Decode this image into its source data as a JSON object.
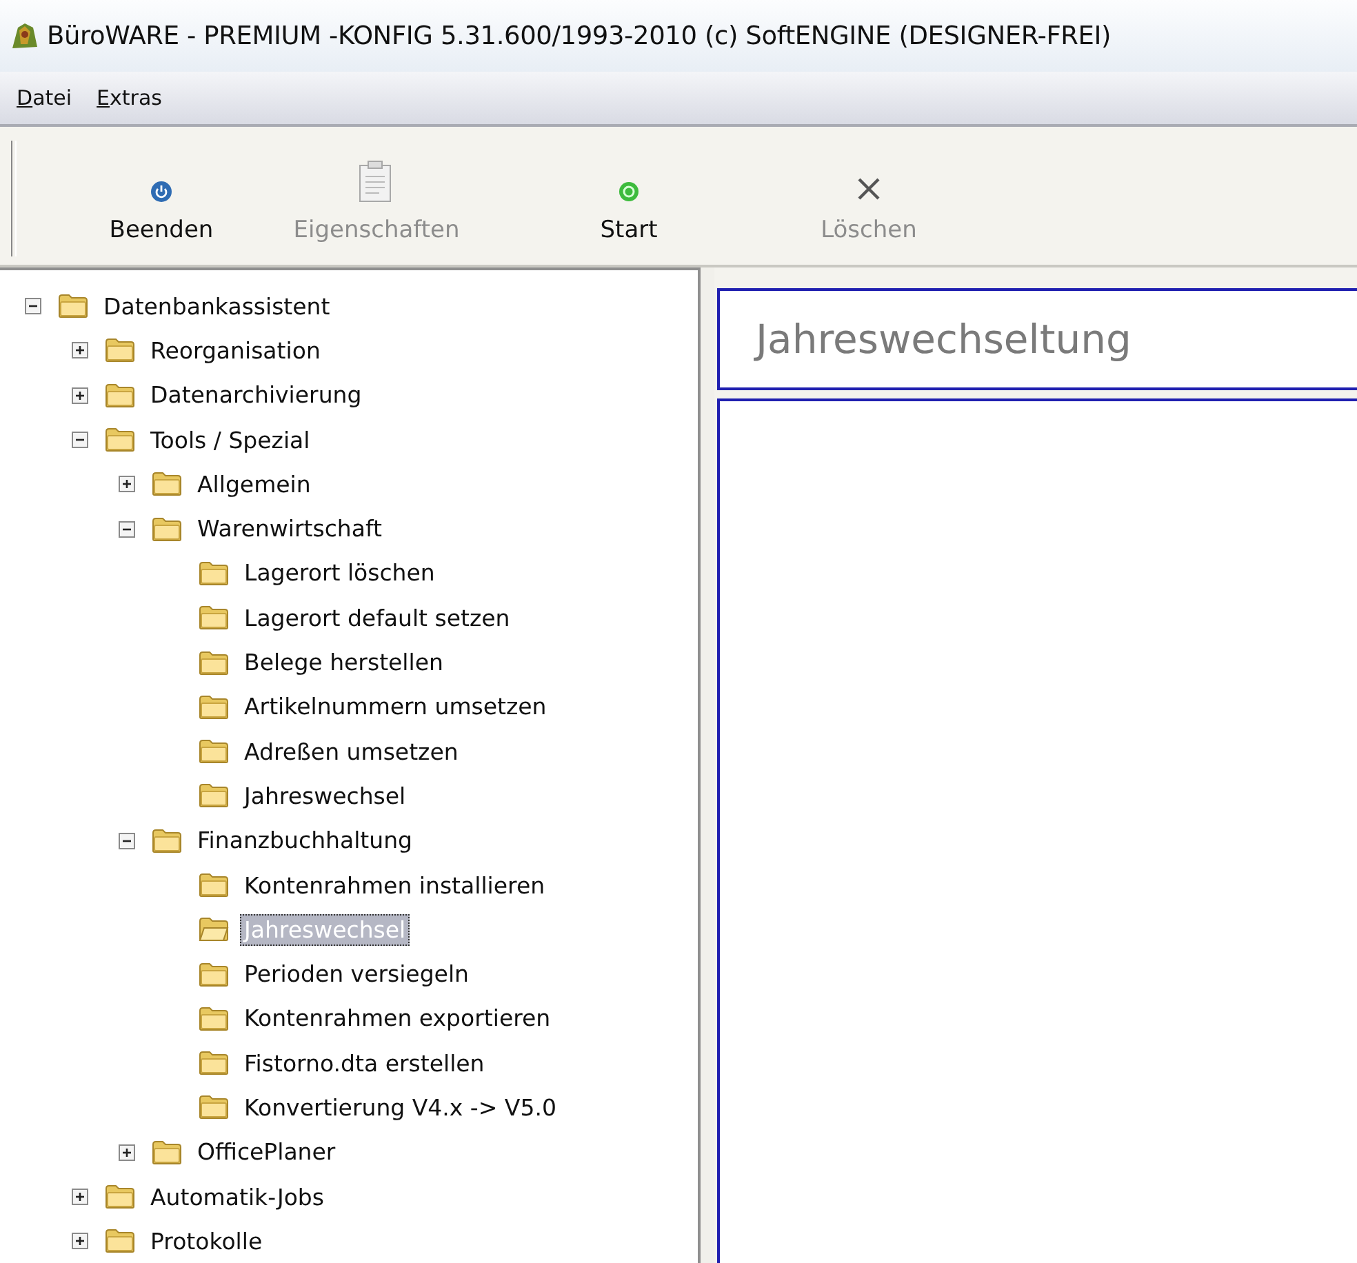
{
  "window": {
    "title": "BüroWARE - PREMIUM -KONFIG 5.31.600/1993-2010 (c) SoftENGINE (DESIGNER-FREI)"
  },
  "menu": [
    "Datei",
    "Extras"
  ],
  "toolbar": [
    {
      "kind": "power",
      "label": "Beenden",
      "disabled": false
    },
    {
      "kind": "properties",
      "label": "Eigenschaften",
      "disabled": true
    },
    {
      "kind": "start",
      "label": "Start",
      "disabled": false
    },
    {
      "kind": "delete",
      "label": "Löschen",
      "disabled": true
    }
  ],
  "tree": [
    {
      "label": "Datenbankassistent",
      "expanded": true,
      "selected": false,
      "children": [
        {
          "label": "Reorganisation",
          "expanded": false,
          "selected": false
        },
        {
          "label": "Datenarchivierung",
          "expanded": false,
          "selected": false
        },
        {
          "label": "Tools / Spezial",
          "expanded": true,
          "selected": false,
          "children": [
            {
              "label": "Allgemein",
              "expanded": false,
              "selected": false
            },
            {
              "label": "Warenwirtschaft",
              "expanded": true,
              "selected": false,
              "children": [
                {
                  "label": "Lagerort löschen",
                  "selected": false
                },
                {
                  "label": "Lagerort default setzen",
                  "selected": false
                },
                {
                  "label": "Belege herstellen",
                  "selected": false
                },
                {
                  "label": "Artikelnummern umsetzen",
                  "selected": false
                },
                {
                  "label": "Adreßen umsetzen",
                  "selected": false
                },
                {
                  "label": "Jahreswechsel",
                  "selected": false
                }
              ]
            },
            {
              "label": "Finanzbuchhaltung",
              "expanded": true,
              "selected": false,
              "children": [
                {
                  "label": "Kontenrahmen installieren",
                  "selected": false
                },
                {
                  "label": "Jahreswechsel",
                  "selected": true
                },
                {
                  "label": "Perioden versiegeln",
                  "selected": false
                },
                {
                  "label": "Kontenrahmen exportieren",
                  "selected": false
                },
                {
                  "label": "Fistorno.dta erstellen",
                  "selected": false
                },
                {
                  "label": "Konvertierung V4.x -> V5.0",
                  "selected": false
                }
              ]
            },
            {
              "label": "OfficePlaner",
              "expanded": false,
              "selected": false
            }
          ]
        },
        {
          "label": "Automatik-Jobs",
          "expanded": false,
          "selected": false
        },
        {
          "label": "Protokolle",
          "expanded": false,
          "selected": false
        }
      ]
    }
  ],
  "detail": {
    "title": "Jahreswechseltung"
  }
}
